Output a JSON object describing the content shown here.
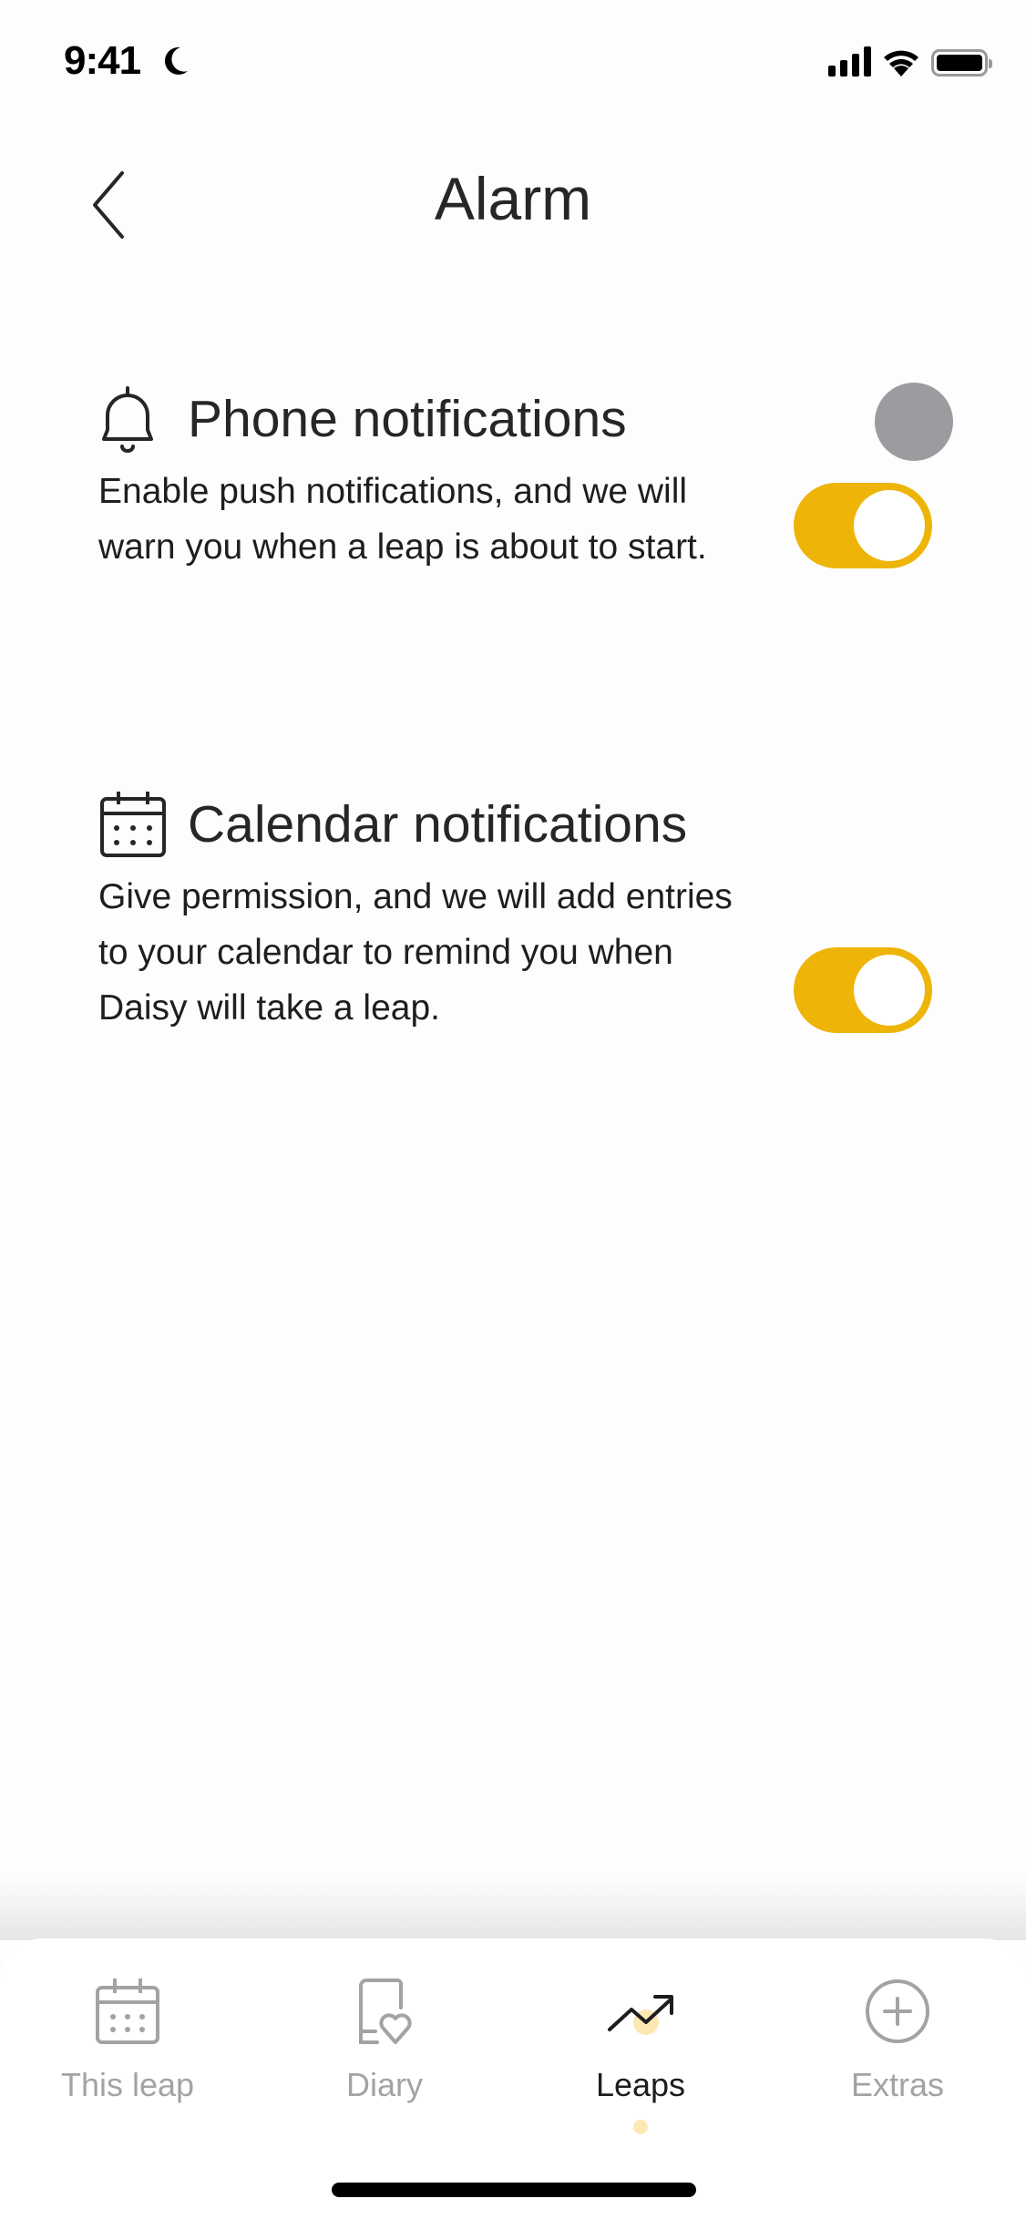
{
  "status_bar": {
    "time": "9:41",
    "icons": [
      "moon-icon",
      "signal-icon",
      "wifi-icon",
      "battery-icon"
    ]
  },
  "header": {
    "title": "Alarm",
    "back_icon": "chevron-left-icon"
  },
  "sections": [
    {
      "icon": "bell-icon",
      "title": "Phone notifications",
      "description": "Enable push notifications, and we will warn you when a leap is about to start.",
      "toggle_on": true
    },
    {
      "icon": "calendar-icon",
      "title": "Calendar notifications",
      "description": "Give permission, and we will add entries to your calendar to remind you when Daisy  will take a leap.",
      "toggle_on": true
    }
  ],
  "tab_bar": {
    "items": [
      {
        "label": "This leap",
        "icon": "calendar-icon",
        "active": false
      },
      {
        "label": "Diary",
        "icon": "diary-heart-icon",
        "active": false
      },
      {
        "label": "Leaps",
        "icon": "trending-up-icon",
        "active": true
      },
      {
        "label": "Extras",
        "icon": "plus-circle-icon",
        "active": false
      }
    ]
  },
  "colors": {
    "accent": "#eeb407",
    "text": "#262528",
    "inactive": "#a3a2a5",
    "active_dot": "#fde7b3",
    "ghost_dot": "#9c9b9f"
  }
}
